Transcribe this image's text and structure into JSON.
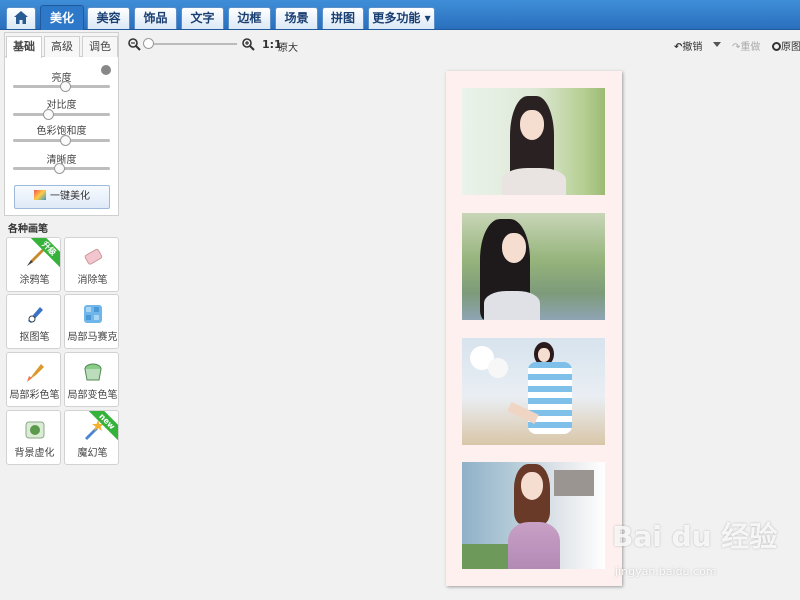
{
  "nav": {
    "items": [
      {
        "label": "美化",
        "active": true
      },
      {
        "label": "美容",
        "active": false
      },
      {
        "label": "饰品",
        "active": false
      },
      {
        "label": "文字",
        "active": false
      },
      {
        "label": "边框",
        "active": false
      },
      {
        "label": "场景",
        "active": false
      },
      {
        "label": "拼图",
        "active": false
      },
      {
        "label": "更多功能 ▾",
        "active": false
      }
    ]
  },
  "panel": {
    "tabs": [
      "基础",
      "高级",
      "调色"
    ],
    "sliders": [
      {
        "label": "亮度",
        "value": 0.55
      },
      {
        "label": "对比度",
        "value": 0.35
      },
      {
        "label": "色彩饱和度",
        "value": 0.55
      },
      {
        "label": "清晰度",
        "value": 0.48
      }
    ],
    "beautify_button": "一键美化"
  },
  "tools": {
    "section_title": "各种画笔",
    "items": [
      {
        "label": "涂鸦笔",
        "icon": "brush-icon",
        "ribbon": "升级"
      },
      {
        "label": "消除笔",
        "icon": "eraser-icon",
        "ribbon": ""
      },
      {
        "label": "抠图笔",
        "icon": "cutout-pen-icon",
        "ribbon": ""
      },
      {
        "label": "局部马赛克",
        "icon": "mosaic-icon",
        "ribbon": ""
      },
      {
        "label": "局部彩色笔",
        "icon": "color-brush-icon",
        "ribbon": ""
      },
      {
        "label": "局部变色笔",
        "icon": "paint-bucket-icon",
        "ribbon": ""
      },
      {
        "label": "背景虚化",
        "icon": "blur-icon",
        "ribbon": ""
      },
      {
        "label": "魔幻笔",
        "icon": "magic-wand-icon",
        "ribbon": "new"
      }
    ]
  },
  "toolbar": {
    "zoom_ratio": "1:1",
    "original_size": "原大",
    "undo": "撤销",
    "redo": "重做",
    "original": "原图"
  },
  "watermark": {
    "main": "Bai du 经验",
    "sub": "jingyan.baidu.com"
  },
  "colors": {
    "nav_bg": "#2e78c9",
    "canvas_bg": "#fdf0ee",
    "ribbon": "#34b23a"
  }
}
